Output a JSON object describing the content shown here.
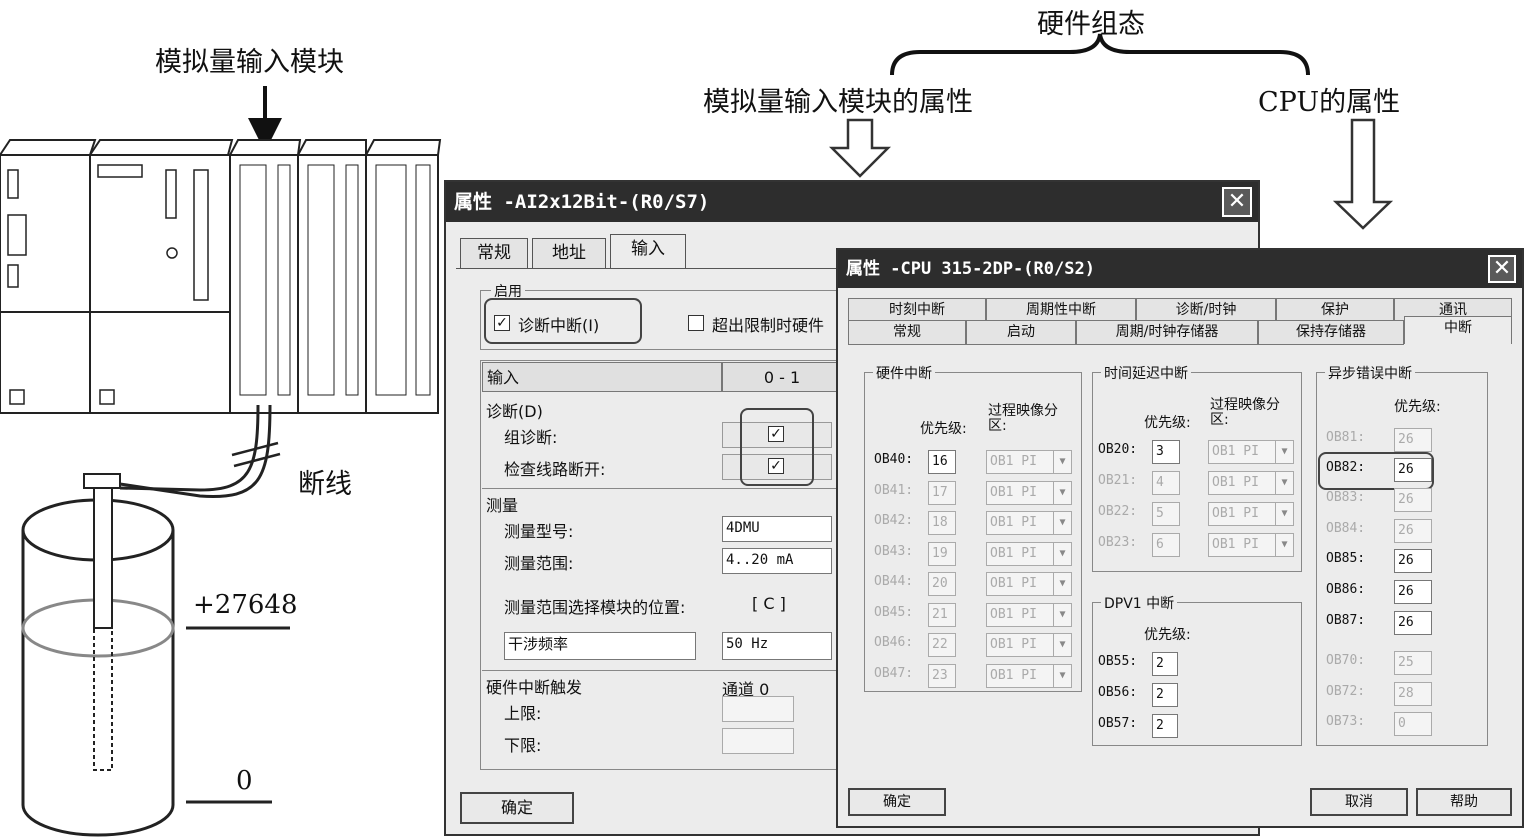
{
  "captions": {
    "module_label": "模拟量输入模块",
    "hw_config": "硬件组态",
    "ai_props": "模拟量输入模块的属性",
    "cpu_props": "CPU的属性",
    "wire_break": "断线",
    "max_value": "+27648",
    "min_value": "0"
  },
  "ai_dialog": {
    "title": "属性 -AI2x12Bit-(R0/S7)",
    "tabs": [
      "常规",
      "地址",
      "输入"
    ],
    "enable_group": "启用",
    "diag_interrupt": "诊断中断(I)",
    "over_limit": "超出限制时硬件",
    "input_header": "输入",
    "channel_header": "0 - 1",
    "diag_label": "诊断(D)",
    "group_diag": "组诊断:",
    "wire_check": "检查线路断开:",
    "measure_label": "测量",
    "measure_type_label": "测量型号:",
    "measure_type_value": "4DMU",
    "measure_range_label": "测量范围:",
    "measure_range_value": "4..20 mA",
    "range_module_label": "测量范围选择模块的位置:",
    "range_module_value": "[ C ]",
    "interference_label": "干涉频率",
    "interference_value": "50 Hz",
    "hw_trigger": "硬件中断触发",
    "channel0": "通道 0",
    "upper": "上限:",
    "lower": "下限:",
    "ok": "确定"
  },
  "cpu_dialog": {
    "title": "属性 -CPU 315-2DP-(R0/S2)",
    "tabs_row1": [
      "时刻中断",
      "周期性中断",
      "诊断/时钟",
      "保护",
      "通讯"
    ],
    "tabs_row2": [
      "常规",
      "启动",
      "周期/时钟存储器",
      "保持存储器",
      "中断"
    ],
    "hw_group": "硬件中断",
    "priority": "优先级:",
    "process_image": "过程映像分区:",
    "hw_rows": [
      {
        "name": "OB40:",
        "prio": "16",
        "pi": "OB1 PI",
        "enabled": true
      },
      {
        "name": "OB41:",
        "prio": "17",
        "pi": "OB1 PI",
        "enabled": false
      },
      {
        "name": "OB42:",
        "prio": "18",
        "pi": "OB1 PI",
        "enabled": false
      },
      {
        "name": "OB43:",
        "prio": "19",
        "pi": "OB1 PI",
        "enabled": false
      },
      {
        "name": "OB44:",
        "prio": "20",
        "pi": "OB1 PI",
        "enabled": false
      },
      {
        "name": "OB45:",
        "prio": "21",
        "pi": "OB1 PI",
        "enabled": false
      },
      {
        "name": "OB46:",
        "prio": "22",
        "pi": "OB1 PI",
        "enabled": false
      },
      {
        "name": "OB47:",
        "prio": "23",
        "pi": "OB1 PI",
        "enabled": false
      }
    ],
    "delay_group": "时间延迟中断",
    "delay_rows": [
      {
        "name": "OB20:",
        "prio": "3",
        "pi": "OB1 PI",
        "enabled": true
      },
      {
        "name": "OB21:",
        "prio": "4",
        "pi": "OB1 PI",
        "enabled": false
      },
      {
        "name": "OB22:",
        "prio": "5",
        "pi": "OB1 PI",
        "enabled": false
      },
      {
        "name": "OB23:",
        "prio": "6",
        "pi": "OB1 PI",
        "enabled": false
      }
    ],
    "dpv1_group": "DPV1 中断",
    "dpv1_rows": [
      {
        "name": "OB55:",
        "prio": "2"
      },
      {
        "name": "OB56:",
        "prio": "2"
      },
      {
        "name": "OB57:",
        "prio": "2"
      }
    ],
    "async_group": "异步错误中断",
    "async_rows": [
      {
        "name": "OB81:",
        "prio": "26",
        "enabled": false
      },
      {
        "name": "OB82:",
        "prio": "26",
        "enabled": true
      },
      {
        "name": "OB83:",
        "prio": "26",
        "enabled": false
      },
      {
        "name": "OB84:",
        "prio": "26",
        "enabled": false
      },
      {
        "name": "OB85:",
        "prio": "26",
        "enabled": true
      },
      {
        "name": "OB86:",
        "prio": "26",
        "enabled": true
      },
      {
        "name": "OB87:",
        "prio": "26",
        "enabled": true
      },
      {
        "name": "OB70:",
        "prio": "25",
        "enabled": false
      },
      {
        "name": "OB72:",
        "prio": "28",
        "enabled": false
      },
      {
        "name": "OB73:",
        "prio": "0",
        "enabled": false
      }
    ],
    "ok": "确定",
    "cancel": "取消",
    "help": "帮助"
  }
}
